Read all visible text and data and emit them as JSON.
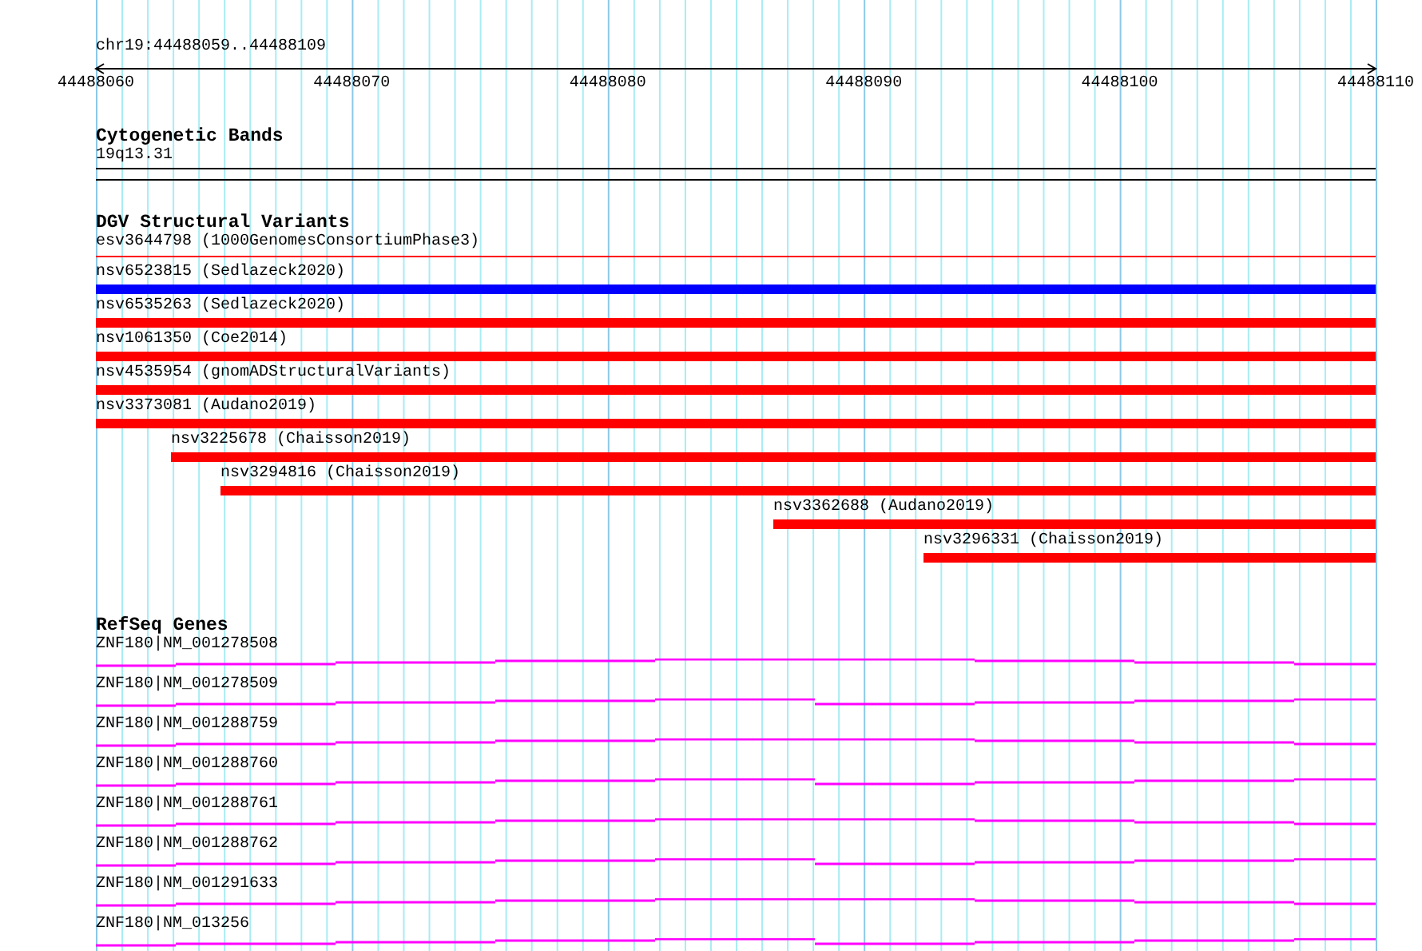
{
  "location": "chr19:44488059..44488109",
  "ruler": {
    "ticks": [
      "44488060",
      "44488070",
      "44488080",
      "44488090",
      "44488100",
      "44488110"
    ]
  },
  "tracks": [
    {
      "title": "Cytogenetic Bands",
      "kind": "bands",
      "features": [
        {
          "label": "19q13.31"
        }
      ]
    },
    {
      "title": "DGV Structural Variants",
      "kind": "variants",
      "features": [
        {
          "label": "esv3644798 (1000GenomesConsortiumPhase3)",
          "kind": "line",
          "color": "#ff0000"
        },
        {
          "label": "nsv6523815 (Sedlazeck2020)",
          "kind": "bar",
          "color": "#0000ff"
        },
        {
          "label": "nsv6535263 (Sedlazeck2020)",
          "kind": "bar",
          "color": "#ff0000"
        },
        {
          "label": "nsv1061350 (Coe2014)",
          "kind": "bar",
          "color": "#ff0000"
        },
        {
          "label": "nsv4535954 (gnomADStructuralVariants)",
          "kind": "bar",
          "color": "#ff0000"
        },
        {
          "label": "nsv3373081 (Audano2019)",
          "kind": "bar",
          "color": "#ff0000"
        },
        {
          "label": "nsv3225678 (Chaisson2019)",
          "kind": "bar",
          "color": "#ff0000"
        },
        {
          "label": "nsv3294816 (Chaisson2019)",
          "kind": "bar",
          "color": "#ff0000"
        },
        {
          "label": "nsv3362688 (Audano2019)",
          "kind": "bar",
          "color": "#ff0000"
        },
        {
          "label": "nsv3296331 (Chaisson2019)",
          "kind": "bar",
          "color": "#ff0000"
        }
      ]
    },
    {
      "title": "RefSeq Genes",
      "kind": "genes",
      "features": [
        {
          "label": "ZNF180|NM_001278508"
        },
        {
          "label": "ZNF180|NM_001278509"
        },
        {
          "label": "ZNF180|NM_001288759"
        },
        {
          "label": "ZNF180|NM_001288760"
        },
        {
          "label": "ZNF180|NM_001288761"
        },
        {
          "label": "ZNF180|NM_001288762"
        },
        {
          "label": "ZNF180|NM_001291633"
        },
        {
          "label": "ZNF180|NM_013256"
        }
      ]
    }
  ]
}
